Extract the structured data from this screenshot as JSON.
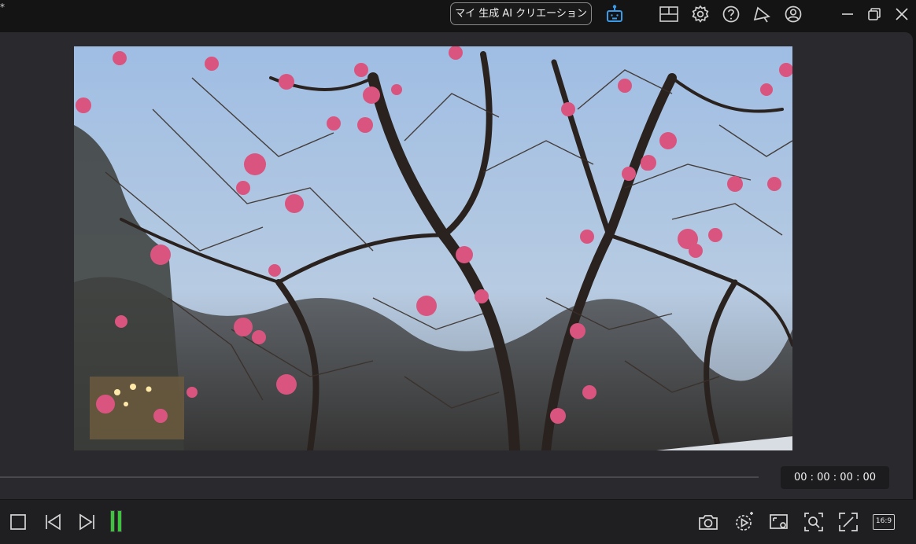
{
  "titlebar": {
    "title_mark": "*",
    "ai_button_label": "マイ 生成 AI クリエーション",
    "icons": [
      "ai-assistant-robot-icon",
      "layout-icon",
      "settings-gear-icon",
      "help-icon",
      "notification-icon",
      "account-icon",
      "minimize-icon",
      "restore-icon",
      "close-icon"
    ]
  },
  "preview": {
    "timecode": "00 : 00 : 00 : 00",
    "colors": {
      "sky": "#a9c3e2",
      "blossom": "#d9557f",
      "branch": "#2b2420",
      "panel": "#2a2a2e"
    }
  },
  "controls": {
    "aspect_ratio": "16:9",
    "audio_level": {
      "left": 1.0,
      "right": 1.0
    },
    "level_color": "#3cc43c",
    "left_icons": [
      "stop-icon",
      "previous-frame-icon",
      "next-frame-icon"
    ],
    "right_icons": [
      "snapshot-camera-icon",
      "play-settings-icon",
      "preview-settings-icon",
      "zoom-icon",
      "fullscreen-icon"
    ]
  }
}
